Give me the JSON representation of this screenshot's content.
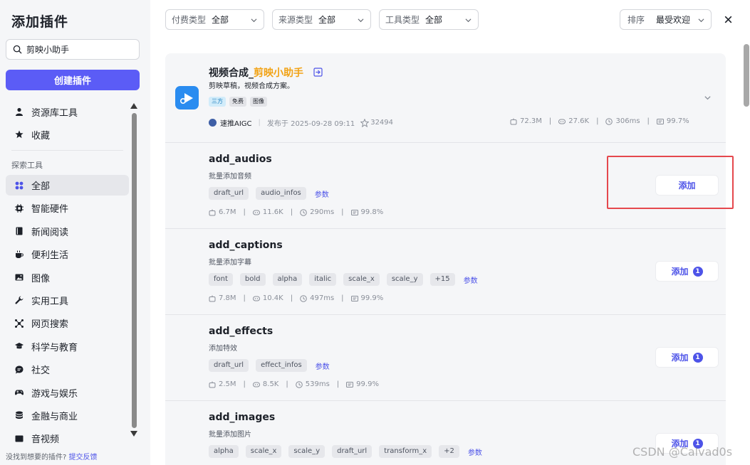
{
  "sidebar": {
    "title": "添加插件",
    "search_value": "剪映小助手",
    "create_label": "创建插件",
    "top_items": [
      {
        "label": "资源库工具",
        "icon": "user-icon"
      },
      {
        "label": "收藏",
        "icon": "star-icon"
      }
    ],
    "section_label": "探索工具",
    "categories": [
      {
        "label": "全部",
        "icon": "grid-icon",
        "active": true
      },
      {
        "label": "智能硬件",
        "icon": "chip-icon"
      },
      {
        "label": "新闻阅读",
        "icon": "book-icon"
      },
      {
        "label": "便利生活",
        "icon": "coffee-icon"
      },
      {
        "label": "图像",
        "icon": "image-icon"
      },
      {
        "label": "实用工具",
        "icon": "wrench-icon"
      },
      {
        "label": "网页搜索",
        "icon": "network-icon"
      },
      {
        "label": "科学与教育",
        "icon": "graduation-cap-icon"
      },
      {
        "label": "社交",
        "icon": "chat-icon"
      },
      {
        "label": "游戏与娱乐",
        "icon": "gamepad-icon"
      },
      {
        "label": "金融与商业",
        "icon": "coins-icon"
      },
      {
        "label": "音视频",
        "icon": "media-icon"
      }
    ],
    "footer_text": "没找到想要的插件?",
    "footer_link": "提交反馈"
  },
  "filters": [
    {
      "label": "付费类型",
      "value": "全部"
    },
    {
      "label": "来源类型",
      "value": "全部"
    },
    {
      "label": "工具类型",
      "value": "全部"
    },
    {
      "label": "排序",
      "value": "最受欢迎"
    }
  ],
  "plugin": {
    "name_prefix": "视频合成_",
    "name_highlight": "剪映小助手",
    "description": "剪映草稿，视频合成方案。",
    "tags": [
      "三方",
      "免费",
      "图像"
    ],
    "author": "速推AIGC",
    "published": "发布于 2025-09-28 09:11",
    "stars": "32494",
    "stats": [
      "72.3M",
      "27.6K",
      "306ms",
      "99.7%"
    ]
  },
  "tools": [
    {
      "name": "add_audios",
      "description": "批量添加音频",
      "params": [
        "draft_url",
        "audio_infos"
      ],
      "params_link": "参数",
      "stats": [
        "6.7M",
        "11.6K",
        "290ms",
        "99.8%"
      ],
      "add_label": "添加",
      "badge": ""
    },
    {
      "name": "add_captions",
      "description": "批量添加字幕",
      "params": [
        "font",
        "bold",
        "alpha",
        "italic",
        "scale_x",
        "scale_y",
        "+15"
      ],
      "params_link": "参数",
      "stats": [
        "7.8M",
        "10.4K",
        "497ms",
        "99.9%"
      ],
      "add_label": "添加",
      "badge": "1"
    },
    {
      "name": "add_effects",
      "description": "添加特效",
      "params": [
        "draft_url",
        "effect_infos"
      ],
      "params_link": "参数",
      "stats": [
        "2.5M",
        "8.5K",
        "539ms",
        "99.9%"
      ],
      "add_label": "添加",
      "badge": "1"
    },
    {
      "name": "add_images",
      "description": "批量添加图片",
      "params": [
        "alpha",
        "scale_x",
        "scale_y",
        "draft_url",
        "transform_x",
        "+2"
      ],
      "params_link": "参数",
      "stats": [],
      "add_label": "添加",
      "badge": "1"
    }
  ],
  "watermark": "CSDN @Calvad0s",
  "colors": {
    "accent": "#5b5cf6",
    "link": "#4d53e8",
    "highlight": "#f2a316",
    "annotation": "#e5484d"
  }
}
